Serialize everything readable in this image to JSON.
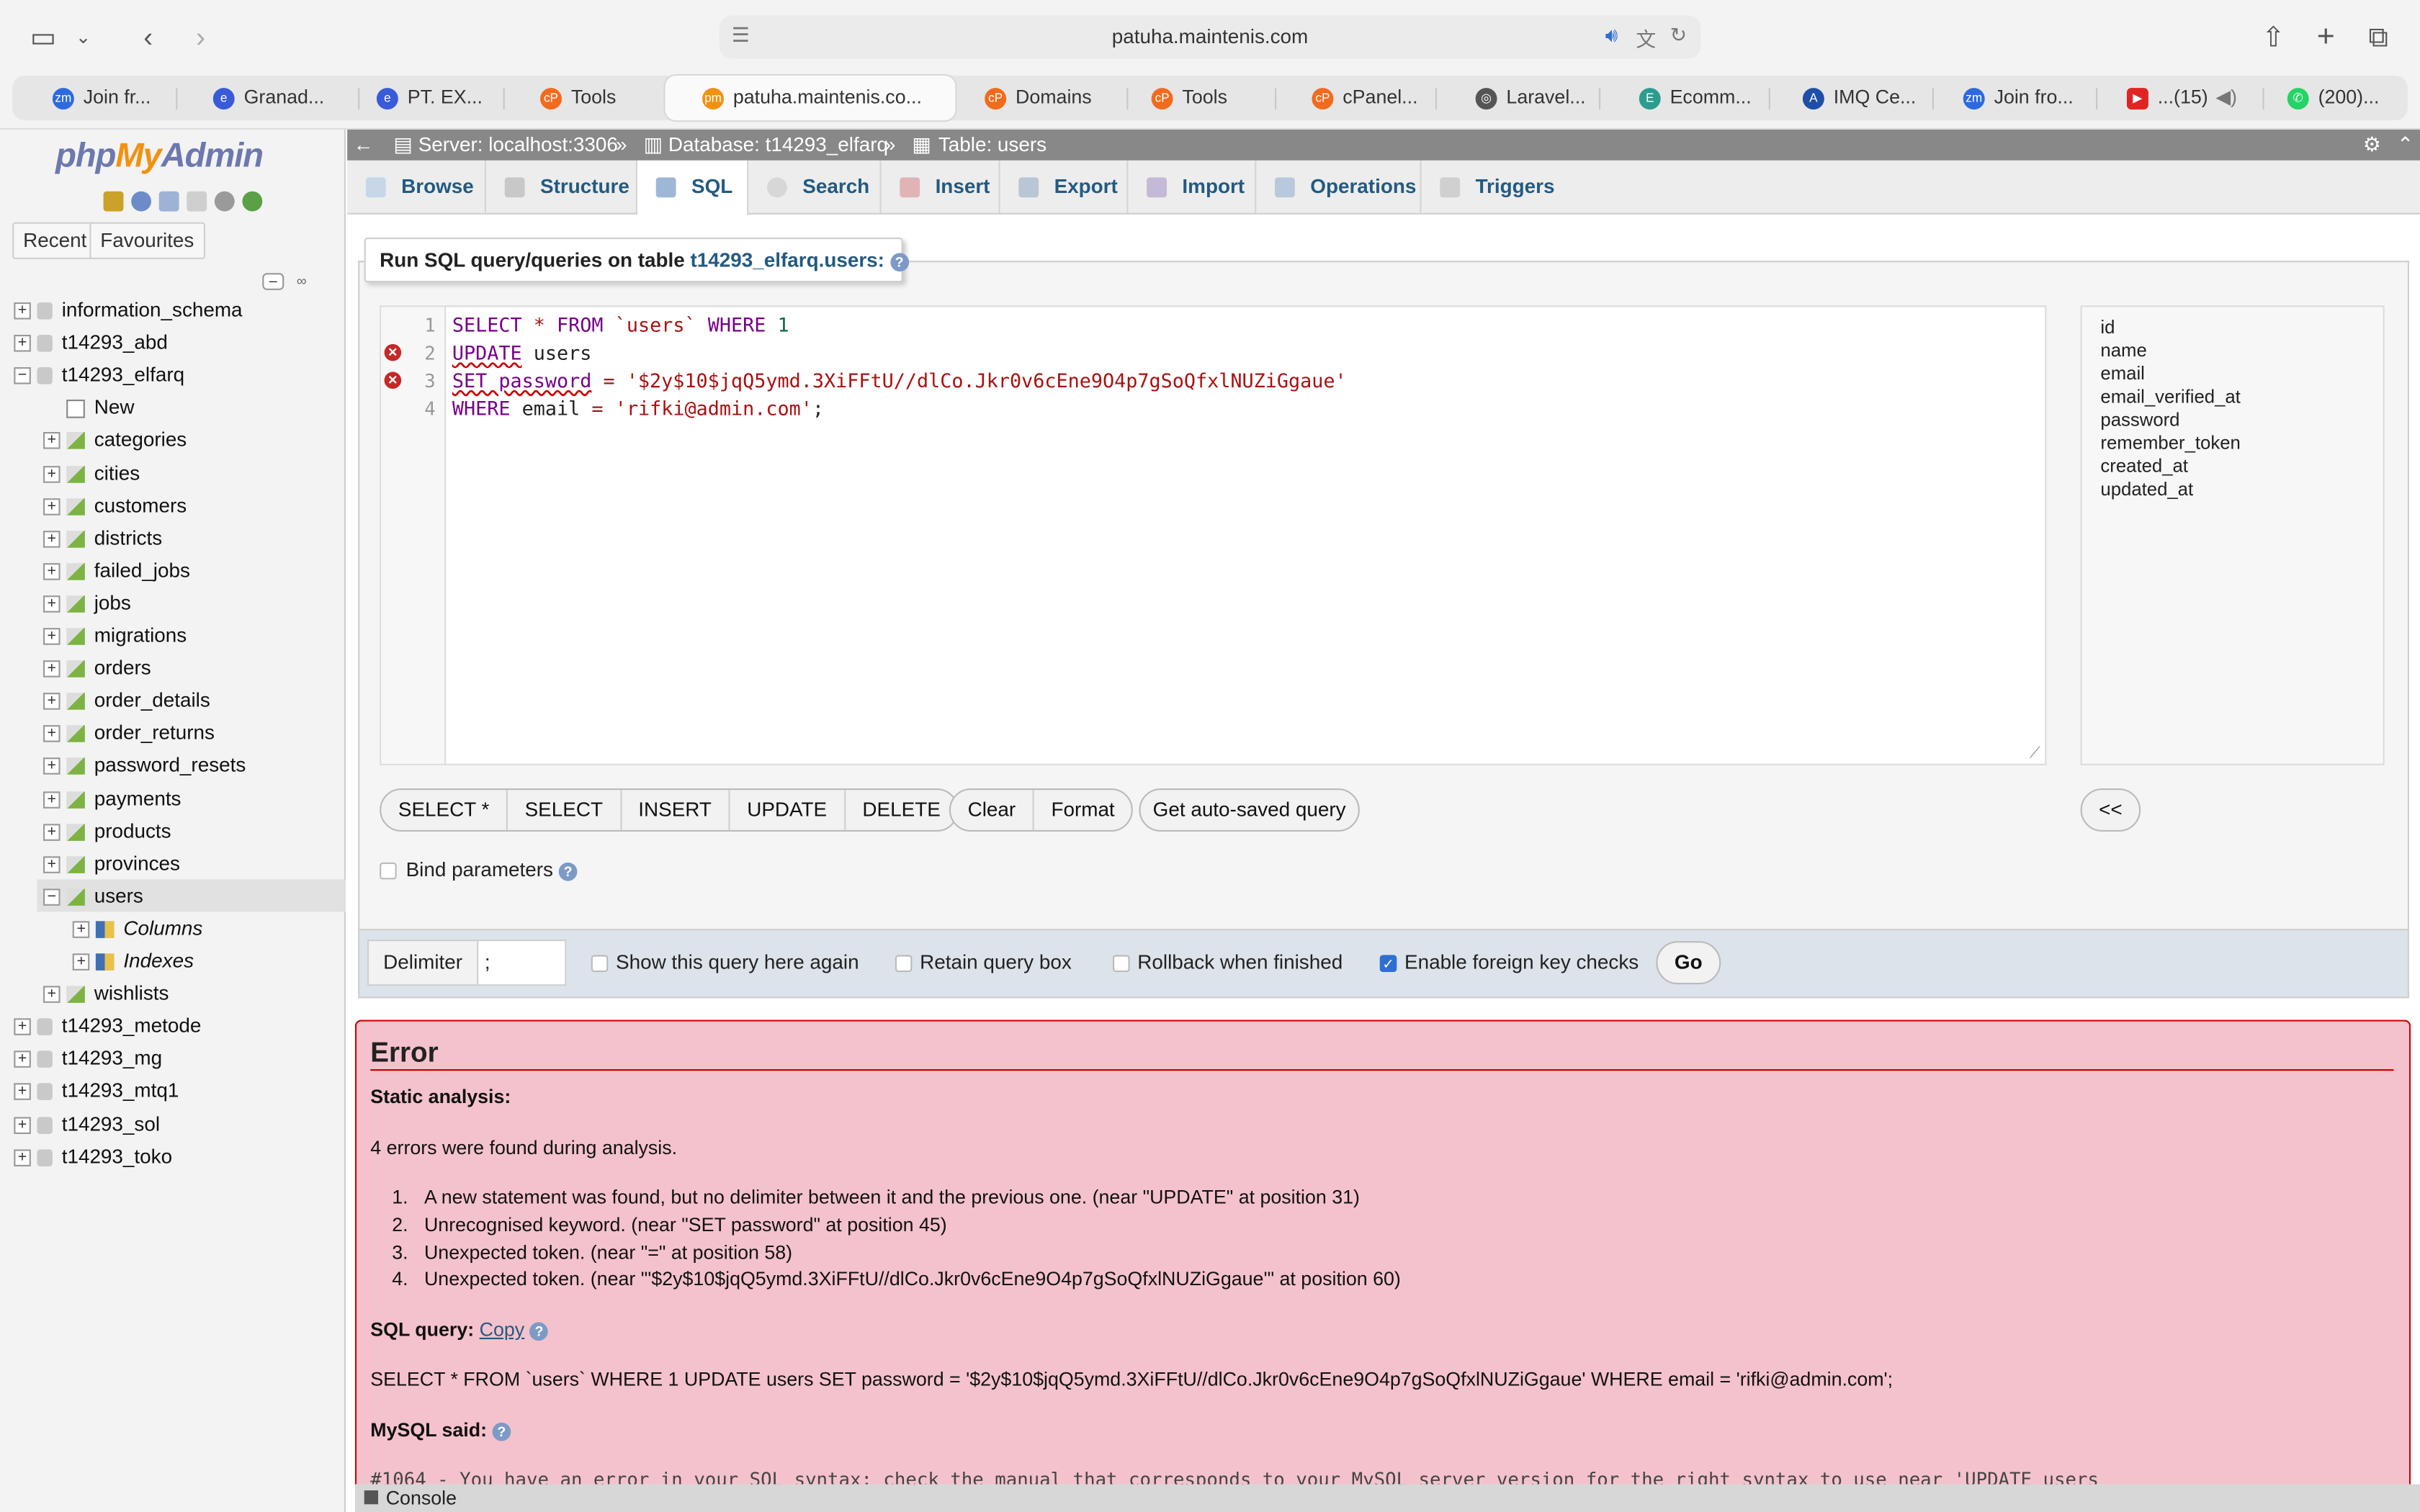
{
  "browser": {
    "url": "patuha.maintenis.com",
    "tabs": [
      {
        "label": "Join fr...",
        "color": "#2d6ae0",
        "icon": "zoom-icon"
      },
      {
        "label": "Granad...",
        "color": "#3a5bd8",
        "icon": "edge-icon"
      },
      {
        "label": "PT. EX...",
        "color": "#3a5bd8",
        "icon": "edge-icon"
      },
      {
        "label": "Tools",
        "color": "#f26b1d",
        "icon": "cpanel-icon"
      },
      {
        "label": "patuha.maintenis.co...",
        "color": "#f29111",
        "icon": "phpmyadmin-icon"
      },
      {
        "label": "Domains",
        "color": "#f26b1d",
        "icon": "cpanel-icon"
      },
      {
        "label": "Tools",
        "color": "#f26b1d",
        "icon": "cpanel-icon"
      },
      {
        "label": "cPanel...",
        "color": "#f26b1d",
        "icon": "cpanel-icon"
      },
      {
        "label": "Laravel...",
        "color": "#555555",
        "icon": "chatgpt-icon"
      },
      {
        "label": "Ecomm...",
        "color": "#2a9d8f",
        "icon": "site-icon"
      },
      {
        "label": "IMQ Ce...",
        "color": "#1e4fa8",
        "icon": "letter-a-icon"
      },
      {
        "label": "Join fro...",
        "color": "#2d6ae0",
        "icon": "zoom-icon"
      },
      {
        "label": "...(15)",
        "color": "#e02424",
        "icon": "youtube-icon"
      },
      {
        "label": "(200)...",
        "color": "#25d366",
        "icon": "whatsapp-icon"
      }
    ]
  },
  "nav": {
    "logo_php": "php",
    "logo_my": "My",
    "logo_admin": "Admin",
    "recent_label": "Recent",
    "favourites_label": "Favourites",
    "databases": [
      {
        "name": "information_schema"
      },
      {
        "name": "t14293_abd"
      },
      {
        "name": "t14293_elfarq"
      }
    ],
    "new_label": "New",
    "tables": [
      "categories",
      "cities",
      "customers",
      "districts",
      "failed_jobs",
      "jobs",
      "migrations",
      "orders",
      "order_details",
      "order_returns",
      "password_resets",
      "payments",
      "products",
      "provinces",
      "users"
    ],
    "columns_label": "Columns",
    "indexes_label": "Indexes",
    "after_tables": [
      "wishlists"
    ],
    "more_databases": [
      "t14293_metode",
      "t14293_mg",
      "t14293_mtq1",
      "t14293_sol",
      "t14293_toko"
    ]
  },
  "breadcrumb": {
    "server": "Server: localhost:3306",
    "database": "Database: t14293_elfarq",
    "table": "Table: users",
    "sep": "»"
  },
  "menu": {
    "browse": "Browse",
    "structure": "Structure",
    "sql": "SQL",
    "search": "Search",
    "insert": "Insert",
    "export": "Export",
    "import": "Import",
    "operations": "Operations",
    "triggers": "Triggers"
  },
  "sql_form": {
    "legend_prefix": "Run SQL query/queries on table ",
    "legend_table": "t14293_elfarq.users:",
    "line_numbers": [
      "1",
      "2",
      "3",
      "4"
    ],
    "columns": [
      "id",
      "name",
      "email",
      "email_verified_at",
      "password",
      "remember_token",
      "created_at",
      "updated_at"
    ],
    "buttons": {
      "select_star": "SELECT *",
      "select": "SELECT",
      "insert": "INSERT",
      "update": "UPDATE",
      "delete": "DELETE",
      "clear": "Clear",
      "format": "Format",
      "autosaved": "Get auto-saved query",
      "collapse": "<<"
    },
    "bind_parameters": "Bind parameters",
    "delimiter_label": "Delimiter",
    "delimiter_value": ";",
    "show_query_again": "Show this query here again",
    "retain_query_box": "Retain query box",
    "rollback": "Rollback when finished",
    "foreign_key": "Enable foreign key checks",
    "go": "Go"
  },
  "error": {
    "title": "Error",
    "static_analysis": "Static analysis:",
    "count": "4 errors were found during analysis.",
    "items": [
      "A new statement was found, but no delimiter between it and the previous one. (near \"UPDATE\" at position 31)",
      "Unrecognised keyword. (near \"SET password\" at position 45)",
      "Unexpected token. (near \"=\" at position 58)",
      "Unexpected token. (near \"'$2y$10$jqQ5ymd.3XiFFtU//dlCo.Jkr0v6cEne9O4p7gSoQfxlNUZiGgaue'\" at position 60)"
    ],
    "sql_query_label": "SQL query:",
    "copy_link": "Copy",
    "sql_query": "SELECT * FROM `users` WHERE 1 UPDATE users SET password = '$2y$10$jqQ5ymd.3XiFFtU//dlCo.Jkr0v6cEne9O4p7gSoQfxlNUZiGgaue' WHERE email = 'rifki@admin.com';",
    "mysql_said": "MySQL said:",
    "mysql_message": "#1064 - You have an error in your SQL syntax; check the manual that corresponds to your MySQL server version for the right syntax to use near 'UPDATE users"
  },
  "console_label": "Console",
  "colors": {
    "accent": "#235a81",
    "error_bg": "#f4c2cc",
    "error_border": "#cc0000"
  }
}
